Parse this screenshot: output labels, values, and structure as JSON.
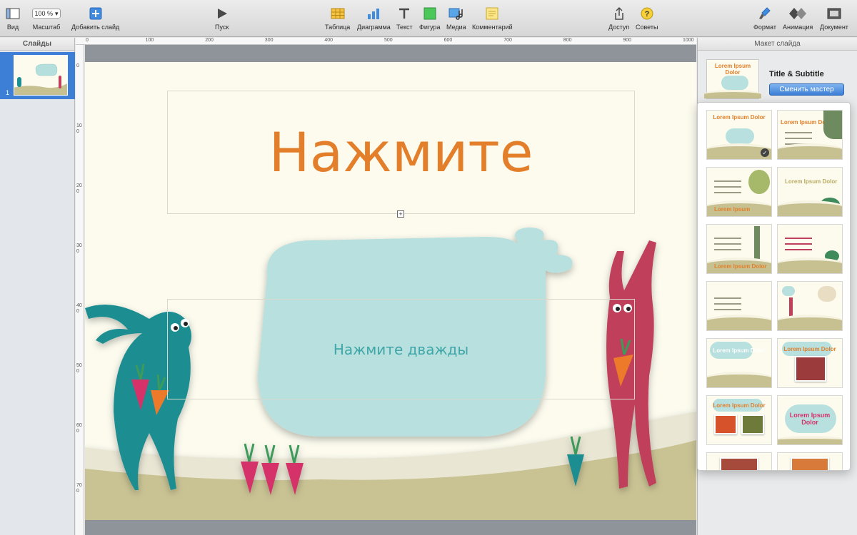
{
  "toolbar": {
    "view": "Вид",
    "zoom_value": "100 %",
    "zoom": "Масштаб",
    "add_slide": "Добавить слайд",
    "play": "Пуск",
    "table": "Таблица",
    "chart": "Диаграмма",
    "text": "Текст",
    "shape": "Фигура",
    "media": "Медиа",
    "comment": "Комментарий",
    "share": "Доступ",
    "tips": "Советы",
    "format": "Формат",
    "animation": "Анимация",
    "document": "Документ"
  },
  "slides_panel": {
    "title": "Слайды",
    "items": [
      {
        "number": "1"
      }
    ]
  },
  "rulers": {
    "top": [
      "0",
      "100",
      "200",
      "300",
      "400",
      "500",
      "600",
      "700",
      "800",
      "900",
      "1000"
    ],
    "left": [
      "0",
      "100",
      "200",
      "300",
      "400",
      "500",
      "600",
      "700"
    ]
  },
  "slide": {
    "title": "Нажмите",
    "subtitle": "Нажмите дважды",
    "colors": {
      "title": "#e37f2a",
      "subtitle": "#3fa7a8",
      "background": "#fcfbee"
    }
  },
  "inspector": {
    "title": "Макет слайда",
    "master_name": "Title & Subtitle",
    "change_master": "Сменить мастер",
    "master_thumb_title": "Lorem Ipsum Dolor"
  },
  "masters": [
    {
      "title": "Lorem Ipsum Dolor",
      "selected": true
    },
    {
      "title": "Lorem Ipsum Dolor"
    },
    {
      "title": "Lorem Ipsum"
    },
    {
      "title": "Lorem Ipsum Dolor"
    },
    {
      "title": "Lorem Ipsum Dolor"
    },
    {
      "title": ""
    },
    {
      "title": ""
    },
    {
      "title": ""
    },
    {
      "title": "Lorem Ipsum Dolor"
    },
    {
      "title": "Lorem Ipsum Dolor"
    },
    {
      "title": "Lorem Ipsum Dolor"
    },
    {
      "title": "Lorem Ipsum Dolor"
    },
    {
      "title": ""
    },
    {
      "title": ""
    }
  ]
}
